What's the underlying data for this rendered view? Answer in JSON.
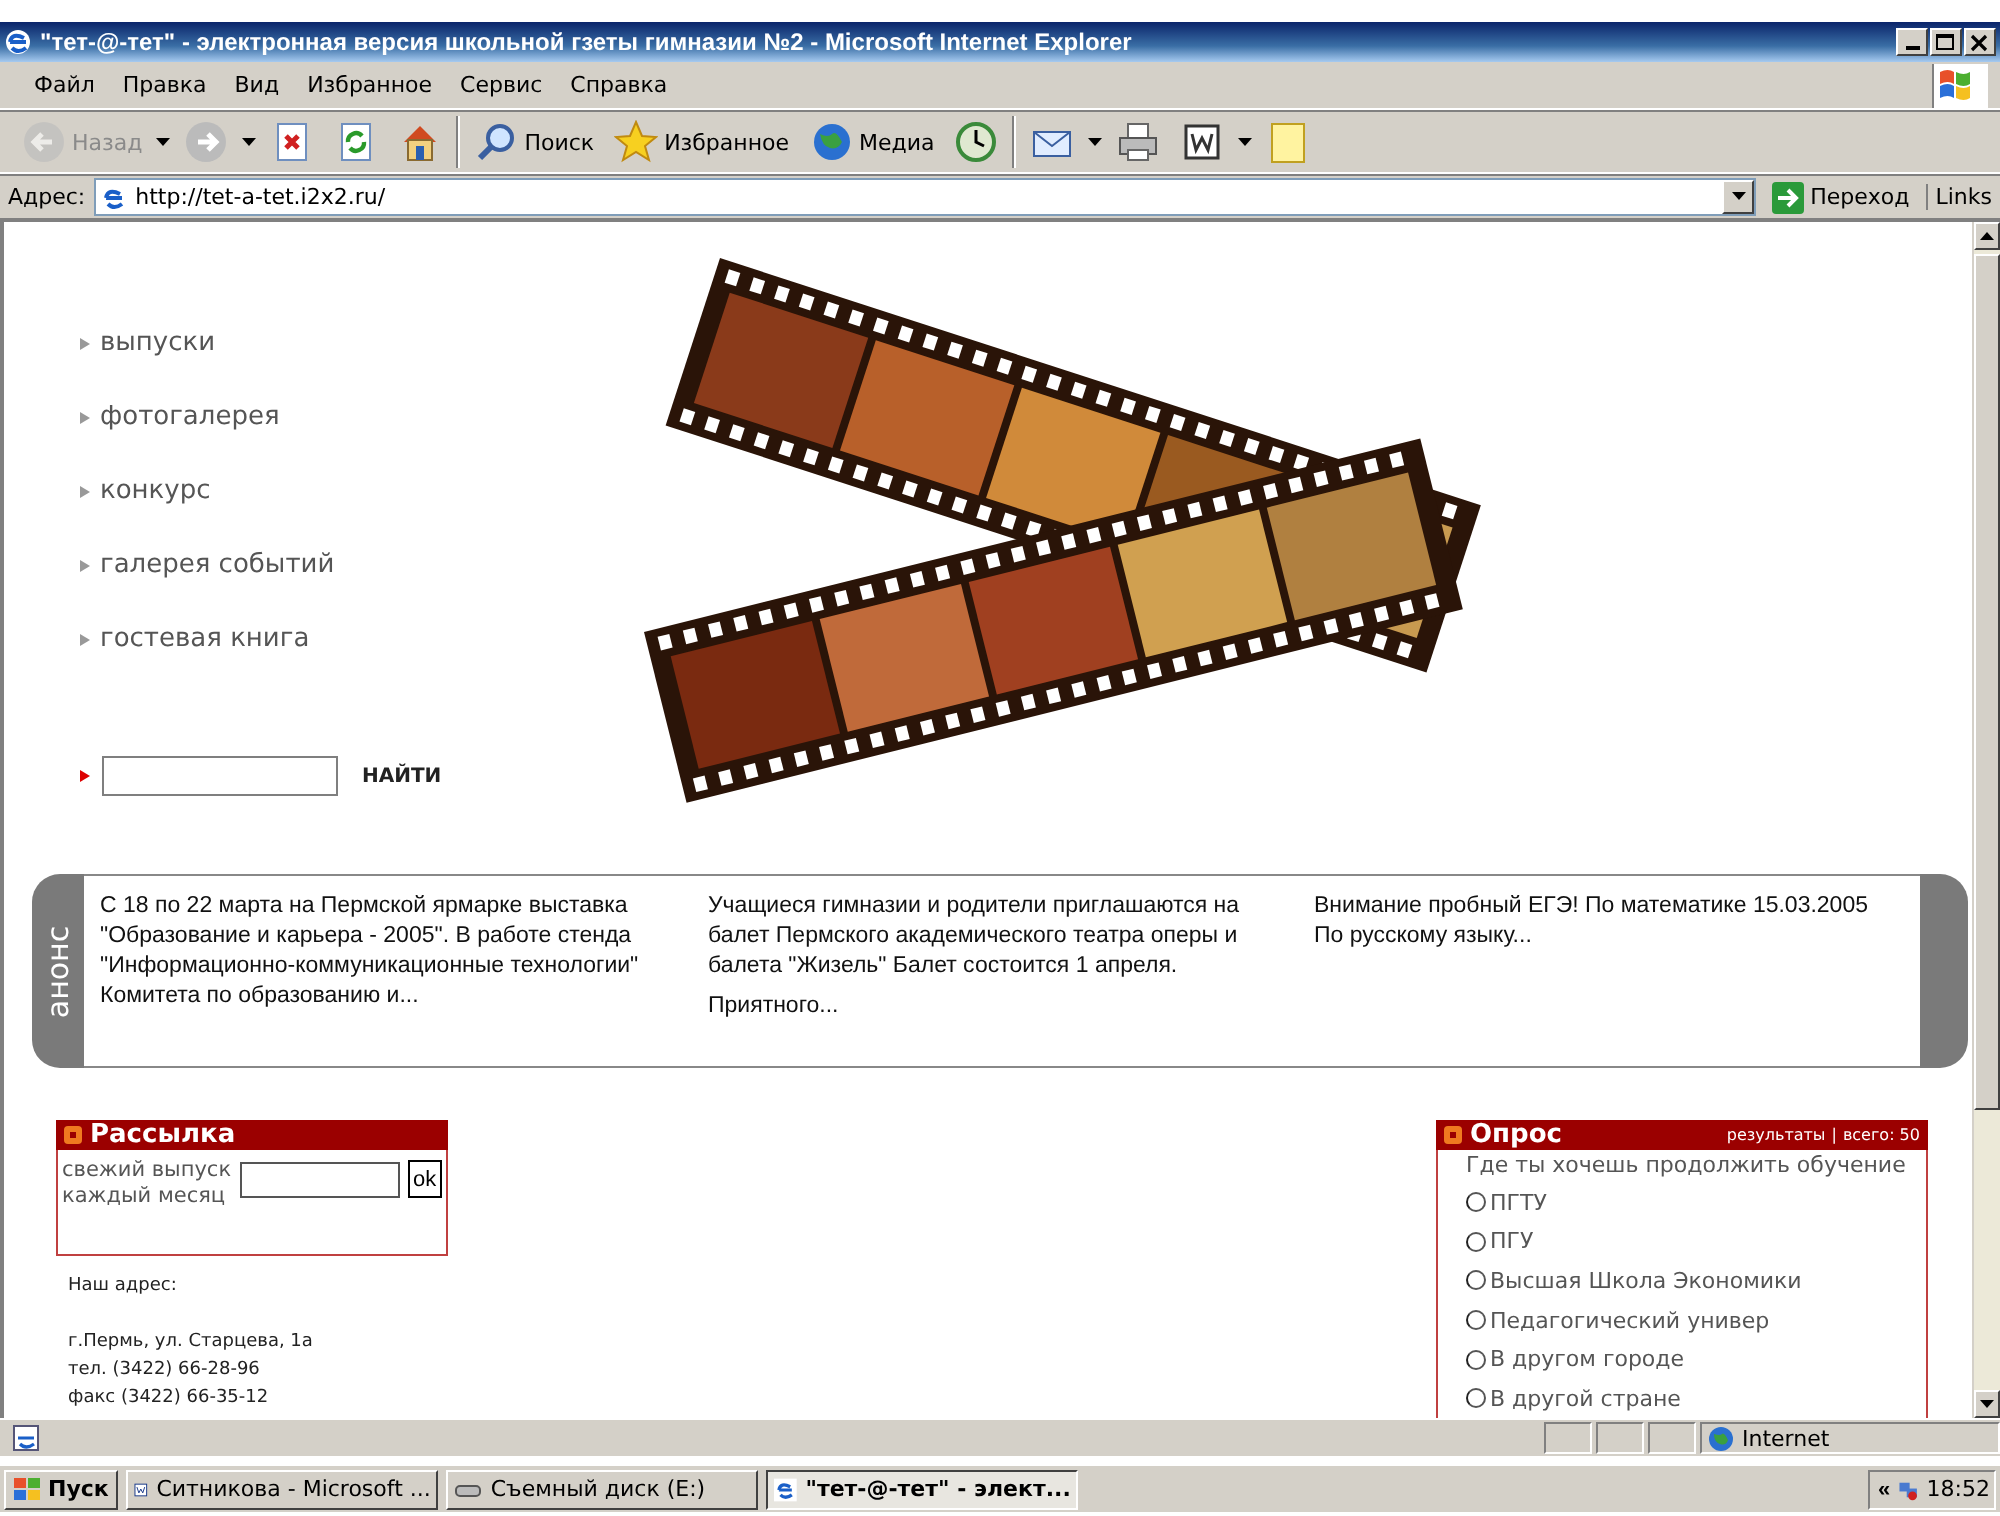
{
  "window": {
    "title": "\"тет-@-тет\" - электронная версия школьной гзеты гимназии №2 - Microsoft Internet Explorer"
  },
  "menu": [
    "Файл",
    "Правка",
    "Вид",
    "Избранное",
    "Сервис",
    "Справка"
  ],
  "toolbar": [
    {
      "kind": "back",
      "label": "Назад",
      "disabled": true
    },
    {
      "kind": "forward",
      "disabled": false
    },
    {
      "kind": "stop"
    },
    {
      "kind": "refresh"
    },
    {
      "kind": "home"
    },
    {
      "kind": "search",
      "label": "Поиск"
    },
    {
      "kind": "favorites",
      "label": "Избранное"
    },
    {
      "kind": "media",
      "label": "Медиа"
    },
    {
      "kind": "history"
    },
    {
      "kind": "mail"
    },
    {
      "kind": "print"
    },
    {
      "kind": "word"
    },
    {
      "kind": "note"
    }
  ],
  "address_bar": {
    "label": "Адрес:",
    "value": "http://tet-a-tet.i2x2.ru/",
    "go": "Переход",
    "links": "Links"
  },
  "page": {
    "nav": [
      "выпуски",
      "фотогалерея",
      "конкурс",
      "галерея событий",
      "гостевая книга"
    ],
    "search": {
      "button": "НАЙТИ"
    },
    "announce": {
      "label": "анонс",
      "items": [
        {
          "paragraphs": [
            "С 18 по 22 марта на Пермской ярмарке выставка \"Образование и карьера - 2005\". В работе стенда \"Информационно-коммуникационные технологии\" Комитета по образованию и..."
          ]
        },
        {
          "paragraphs": [
            "Учащиеся гимназии и родители приглашаются на балет Пермского академического театра оперы и балета \"Жизель\" Балет состоится 1 апреля.",
            "Приятного..."
          ]
        },
        {
          "paragraphs": [
            "Внимание пробный ЕГЭ! По математике 15.03.2005 По русскому языку..."
          ]
        }
      ]
    },
    "subscribe": {
      "title": "Рассылка",
      "text_lines": [
        "свежий выпуск",
        "каждый месяц"
      ],
      "button": "ok"
    },
    "contact": {
      "heading": "Наш адрес:",
      "lines": [
        "г.Пермь, ул. Старцева, 1а",
        "тел. (3422) 66-28-96",
        "факс (3422) 66-35-12"
      ]
    },
    "poll": {
      "title": "Опрос",
      "results": "результаты",
      "separator": "|",
      "total": "всего: 50",
      "question": "Где ты хочешь продолжить обучение",
      "options": [
        {
          "label": "ПГТУ",
          "selected": false
        },
        {
          "label": "ПГУ",
          "selected": false
        },
        {
          "label": "Высшая Школа Экономики",
          "selected": false
        },
        {
          "label": "Педагогический универ",
          "selected": false
        },
        {
          "label": "В другом городе",
          "selected": false
        },
        {
          "label": "В другой стране",
          "selected": false
        }
      ]
    }
  },
  "status_bar": {
    "zone": "Internet"
  },
  "taskbar": {
    "start": "Пуск",
    "tasks": [
      {
        "kind": "word",
        "label": "Ситникова - Microsoft ...",
        "selected": false
      },
      {
        "kind": "drive",
        "label": "Съемный диск (E:)",
        "selected": false
      },
      {
        "kind": "ie",
        "label": "\"тет-@-тет\" - элект...",
        "selected": true
      }
    ],
    "tray_toggle": "«",
    "clock": "18:52"
  }
}
